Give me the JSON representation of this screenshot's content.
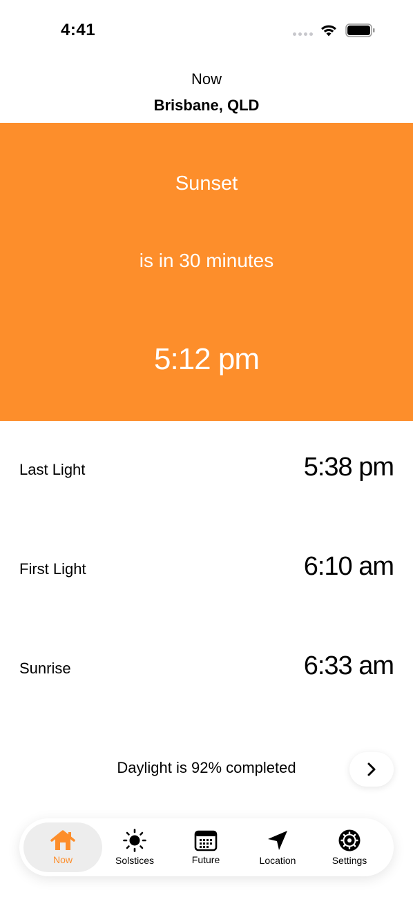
{
  "status_bar": {
    "time": "4:41"
  },
  "header": {
    "subtitle": "Now",
    "location": "Brisbane, QLD"
  },
  "hero": {
    "event": "Sunset",
    "countdown": "is in 30 minutes",
    "time": "5:12 pm",
    "background_color": "#fd8e2b"
  },
  "rows": [
    {
      "label": "Last Light",
      "value": "5:38 pm"
    },
    {
      "label": "First Light",
      "value": "6:10 am"
    },
    {
      "label": "Sunrise",
      "value": "6:33 am"
    }
  ],
  "daylight": {
    "text": "Daylight is 92% completed",
    "next_icon": "chevron-right-icon"
  },
  "tabs": [
    {
      "label": "Now",
      "icon": "home-icon",
      "active": true
    },
    {
      "label": "Solstices",
      "icon": "sun-icon",
      "active": false
    },
    {
      "label": "Future",
      "icon": "calendar-icon",
      "active": false
    },
    {
      "label": "Location",
      "icon": "location-arrow-icon",
      "active": false
    },
    {
      "label": "Settings",
      "icon": "gear-icon",
      "active": false
    }
  ],
  "colors": {
    "accent": "#fd8e2b"
  }
}
